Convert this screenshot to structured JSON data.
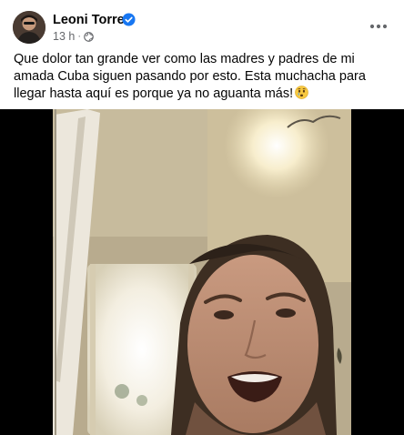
{
  "post": {
    "author": "Leoni Torres",
    "timestamp": "13 h",
    "separator": "·",
    "text": "Que dolor tan grande ver como las madres y padres de mi amada Cuba siguen pasando por esto. Esta muchacha para llegar hasta aquí es porque ya no aguanta más!",
    "icons": {
      "verified": "verified-badge-icon",
      "privacy": "globe-icon",
      "more": "more-options-icon",
      "emoji": "crying-face-emoji"
    }
  },
  "colors": {
    "verified_blue": "#1877f2",
    "meta_gray": "#65676b",
    "text": "#050505"
  }
}
